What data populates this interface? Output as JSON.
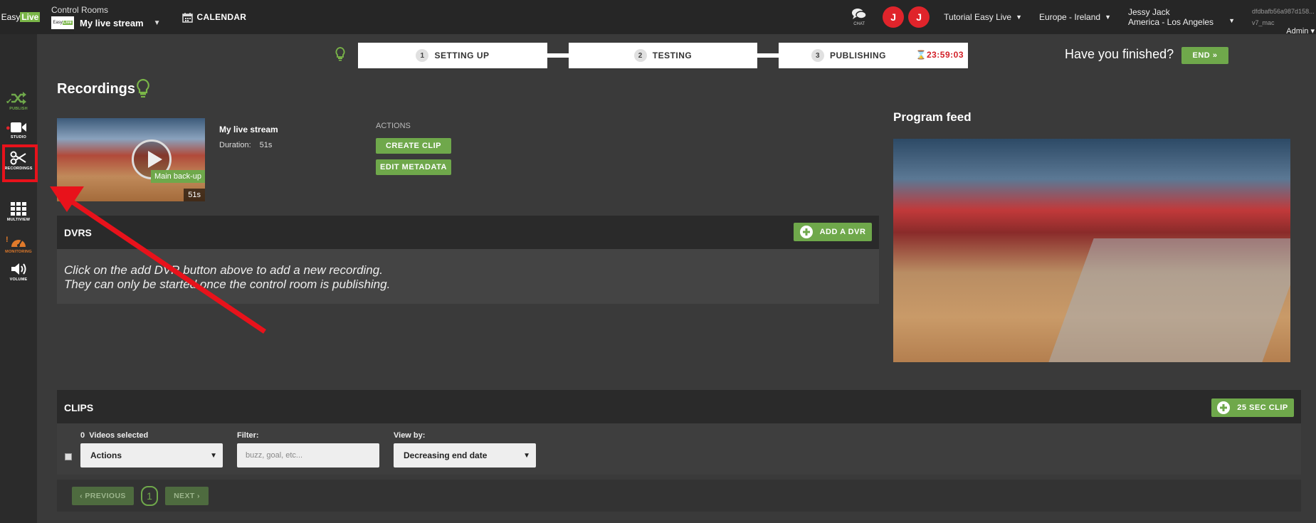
{
  "topbar": {
    "logo_a": "Easy",
    "logo_b": "Live",
    "control_rooms_label": "Control Rooms",
    "stream_name": "My live stream",
    "calendar_label": "CALENDAR",
    "chat_label": "CHAT",
    "avatars": [
      "J",
      "J"
    ],
    "tutorial": "Tutorial Easy Live",
    "region": "Europe - Ireland",
    "user_name": "Jessy Jack",
    "user_tz": "America - Los Angeles",
    "meta_id": "dfdbafb56a987d158...",
    "meta_host": "v7_mac",
    "role": "Admin"
  },
  "sidebar": {
    "items": [
      {
        "label": "PUBLISH",
        "icon": "shuffle-icon",
        "color": "#6fa84b"
      },
      {
        "label": "STUDIO",
        "icon": "video-camera-icon",
        "color": "#ffffff"
      },
      {
        "label": "RECORDINGS",
        "icon": "scissors-icon",
        "color": "#ffffff"
      },
      {
        "label": "MULTIVIEW",
        "icon": "grid-icon",
        "color": "#ffffff"
      },
      {
        "label": "MONITORING",
        "icon": "dashboard-icon",
        "color": "#e07a2b"
      },
      {
        "label": "VOLUME",
        "icon": "volume-icon",
        "color": "#ffffff"
      }
    ]
  },
  "steps": [
    {
      "num": "1",
      "label": "SETTING UP"
    },
    {
      "num": "2",
      "label": "TESTING"
    },
    {
      "num": "3",
      "label": "PUBLISHING"
    }
  ],
  "timer": "23:59:03",
  "finished_text": "Have you finished?",
  "end_label": "END",
  "page_title": "Recordings",
  "recording": {
    "badge": "Main back-up",
    "thumb_duration": "51s",
    "title": "My live stream",
    "duration_label": "Duration:",
    "duration_value": "51s"
  },
  "actions": {
    "label": "ACTIONS",
    "create_clip": "CREATE CLIP",
    "edit_metadata": "EDIT METADATA"
  },
  "dvrs": {
    "title": "DVRS",
    "add_label": "ADD A DVR",
    "line1": "Click on the add DVR button above to add a new recording.",
    "line2": "They can only be started once the control room is publishing."
  },
  "program_feed": {
    "title": "Program feed"
  },
  "clips": {
    "title": "CLIPS",
    "clip_button": "25 SEC CLIP",
    "selected_count": "0",
    "selected_label": "Videos selected",
    "actions_value": "Actions",
    "filter_label": "Filter:",
    "filter_placeholder": "buzz, goal, etc...",
    "viewby_label": "View by:",
    "viewby_value": "Decreasing end date"
  },
  "pagination": {
    "previous": "PREVIOUS",
    "page": "1",
    "next": "NEXT"
  },
  "colors": {
    "accent": "#6fa84b",
    "alert": "#e8121b",
    "timer": "#d21e26"
  }
}
